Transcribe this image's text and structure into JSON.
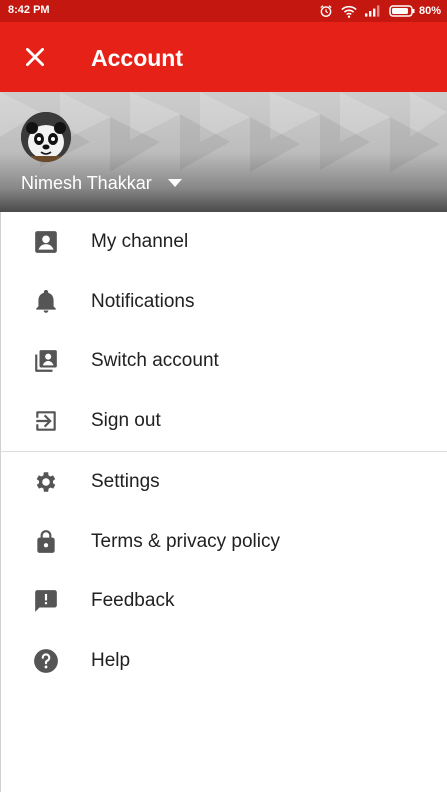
{
  "status_bar": {
    "time": "8:42 PM",
    "battery": "80%",
    "icons": [
      "alarm-icon",
      "wifi-icon",
      "signal-icon",
      "battery-icon"
    ]
  },
  "app_bar": {
    "title": "Account",
    "close_icon": "close-icon",
    "background": "#e62117"
  },
  "account": {
    "name": "Nimesh Thakkar"
  },
  "menu": {
    "group1": [
      {
        "label": "My channel",
        "icon": "account-box-icon"
      },
      {
        "label": "Notifications",
        "icon": "bell-icon"
      },
      {
        "label": "Switch account",
        "icon": "switch-account-icon"
      },
      {
        "label": "Sign out",
        "icon": "sign-out-icon"
      }
    ],
    "group2": [
      {
        "label": "Settings",
        "icon": "gear-icon"
      },
      {
        "label": "Terms & privacy policy",
        "icon": "lock-icon"
      },
      {
        "label": "Feedback",
        "icon": "feedback-icon"
      },
      {
        "label": "Help",
        "icon": "help-icon"
      }
    ]
  }
}
